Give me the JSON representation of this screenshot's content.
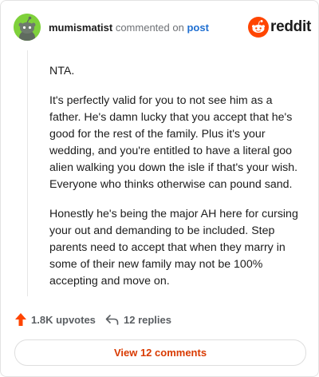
{
  "header": {
    "username": "mumismatist",
    "action": "commented on",
    "post_link": "post",
    "brand": "reddit",
    "avatar_icon": "snoo-avatar-icon",
    "avatar_color": "#7fd13b"
  },
  "comment": {
    "paragraphs": [
      "NTA.",
      "It's perfectly valid for you to not see him as a father. He's damn lucky that you accept that he's good for the rest of the family. Plus it's your wedding, and you're entitled to have a literal goo alien walking you down the isle if that's your wish. Everyone who thinks otherwise can pound sand.",
      "Honestly he's being the major AH here for cursing your out and demanding to be included. Step parents need to accept that when they marry in some of their new family may not be 100% accepting and move on."
    ]
  },
  "footer": {
    "upvotes": "1.8K upvotes",
    "upvote_icon": "upvote-arrow-icon",
    "replies": "12 replies",
    "reply_icon": "reply-arrow-icon"
  },
  "view_comments": "View 12 comments",
  "colors": {
    "brand_orange": "#ff4500",
    "link_blue": "#1f6fd1",
    "action_orange": "#d93a00"
  }
}
